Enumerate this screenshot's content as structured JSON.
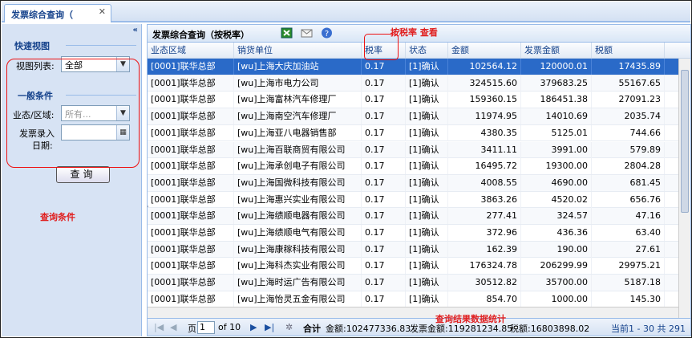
{
  "tab": {
    "title": "发票综合查询（",
    "close": "✕"
  },
  "sidebar": {
    "collapse": "«",
    "quick_view_title": "快速视图",
    "view_list_label": "视图列表:",
    "view_list_value": "全部",
    "general_title": "一般条件",
    "region_label": "业态/区域:",
    "region_placeholder": "所有...",
    "date_label_1": "发票录入",
    "date_label_2": "日期:",
    "date_value": "",
    "query_button": "查询",
    "annotation": "查询条件"
  },
  "grid": {
    "title": "发票综合查询（按税率）",
    "annotation_top": "按税率 查看",
    "annotation_bottom": "查询结果数据统计",
    "columns": [
      "业态区域",
      "销货单位",
      "税率",
      "状态",
      "金额",
      "发票金额",
      "税额"
    ],
    "rows": [
      [
        "[0001]联华总部",
        "[wu]上海大庆加油站",
        "0.17",
        "[1]确认",
        "102564.12",
        "120000.01",
        "17435.89"
      ],
      [
        "[0001]联华总部",
        "[wu]上海市电力公司",
        "0.17",
        "[1]确认",
        "324515.60",
        "379683.25",
        "55167.65"
      ],
      [
        "[0001]联华总部",
        "[wu]上海富林汽车修理厂",
        "0.17",
        "[1]确认",
        "159360.15",
        "186451.38",
        "27091.23"
      ],
      [
        "[0001]联华总部",
        "[wu]上海南空汽车修理厂",
        "0.17",
        "[1]确认",
        "11974.95",
        "14010.69",
        "2035.74"
      ],
      [
        "[0001]联华总部",
        "[wu]上海亚八电器销售部",
        "0.17",
        "[1]确认",
        "4380.35",
        "5125.01",
        "744.66"
      ],
      [
        "[0001]联华总部",
        "[wu]上海百联商贸有限公司",
        "0.17",
        "[1]确认",
        "3411.11",
        "3991.00",
        "579.89"
      ],
      [
        "[0001]联华总部",
        "[wu]上海承创电子有限公司",
        "0.17",
        "[1]确认",
        "16495.72",
        "19300.00",
        "2804.28"
      ],
      [
        "[0001]联华总部",
        "[wu]上海国微科技有限公司",
        "0.17",
        "[1]确认",
        "4008.55",
        "4690.00",
        "681.45"
      ],
      [
        "[0001]联华总部",
        "[wu]上海惠兴实业有限公司",
        "0.17",
        "[1]确认",
        "3863.26",
        "4520.02",
        "656.76"
      ],
      [
        "[0001]联华总部",
        "[wu]上海绩顺电器有限公司",
        "0.17",
        "[1]确认",
        "277.41",
        "324.57",
        "47.16"
      ],
      [
        "[0001]联华总部",
        "[wu]上海绩顺电气有限公司",
        "0.17",
        "[1]确认",
        "372.96",
        "436.36",
        "63.40"
      ],
      [
        "[0001]联华总部",
        "[wu]上海康稼科技有限公司",
        "0.17",
        "[1]确认",
        "162.39",
        "190.00",
        "27.61"
      ],
      [
        "[0001]联华总部",
        "[wu]上海科杰实业有限公司",
        "0.17",
        "[1]确认",
        "176324.78",
        "206299.99",
        "29975.21"
      ],
      [
        "[0001]联华总部",
        "[wu]上海时运广告有限公司",
        "0.17",
        "[1]确认",
        "30512.82",
        "35700.00",
        "5187.18"
      ],
      [
        "[0001]联华总部",
        "[wu]上海怡灵五金有限公司",
        "0.17",
        "[1]确认",
        "854.70",
        "1000.00",
        "145.30"
      ],
      [
        "[0001]联华总部",
        "[wu]上海百胜技实业有限公司",
        "0.17",
        "[1]确认",
        "",
        "24190.00",
        "4051.70"
      ]
    ],
    "pager": {
      "page_prefix": "页",
      "page_value": "1",
      "page_of": "of 10",
      "total_label": "合计",
      "amount": "金额:102477336.83",
      "invoice_amount": "发票金额:119281234.85",
      "tax_amount": "税额:16803898.02",
      "range": "当前1 - 30 共 291"
    }
  }
}
